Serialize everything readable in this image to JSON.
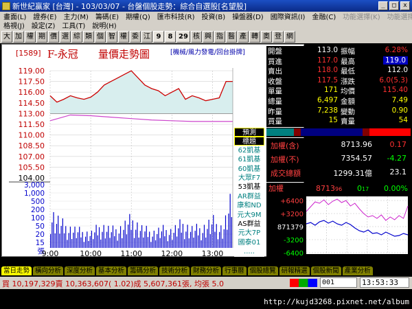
{
  "titlebar": {
    "title": "新世紀贏家 [台灣] - 103/03/07 - 台盤個股走勢：綜合自選股[名望股]",
    "min": "_",
    "max": "□",
    "close": "x"
  },
  "menus_row1": [
    "畫面(L)",
    "證券(E)",
    "主力(M)",
    "籌碼(E)",
    "期權(Q)",
    "匯市科技(R)",
    "投資(B)",
    "操盤器(D)",
    "國際資訊(I)",
    "金融(C)",
    "功能選擇(K)",
    "功能選擇(K)"
  ],
  "menus_row2": [
    "格視(J)",
    "設定(Z)",
    "工具(T)",
    "說明(H)"
  ],
  "toolbar_buttons": [
    "大",
    "加",
    "權",
    "期",
    "價",
    "選",
    "綜",
    "類",
    "個",
    "智",
    "權",
    "委",
    "江",
    "9",
    "8",
    "29",
    "核",
    "興",
    "指",
    "醫",
    "產",
    "轉",
    "奧",
    "登",
    "網"
  ],
  "chart": {
    "code": "[1589]",
    "name": "F-永冠",
    "subtitle": "量價走勢圖",
    "tags": "[機械/風力發電/回台掛牌]",
    "price_ticks": [
      "119.00",
      "117.50",
      "116.00",
      "114.50",
      "113.00",
      "111.50",
      "110.00",
      "108.50",
      "107.00",
      "105.50",
      "104.00"
    ],
    "volume_ticks": [
      "3,000",
      "1,000",
      "500",
      "200",
      "100",
      "50",
      "20",
      "15",
      "張"
    ],
    "time_ticks": [
      "9:00",
      "10:00",
      "11:00",
      "12:00",
      "13:00"
    ],
    "side_labels": [
      "預測",
      "標題",
      "62凱基",
      "61凱基",
      "60凱基",
      "大眾F7",
      "53凱基",
      "AR群益",
      "康和ND",
      "元大9M",
      "AS群益",
      "元大7P",
      "國泰01",
      "....."
    ]
  },
  "chart_data": {
    "type": "line",
    "title": "量價走勢圖",
    "xlabel": "",
    "ylabel": "",
    "x_ticks": [
      "9:00",
      "10:00",
      "11:00",
      "12:00",
      "13:00"
    ],
    "ylim": [
      104.0,
      119.0
    ],
    "series": [
      {
        "x": [
          "09:00",
          "09:10",
          "09:20",
          "09:30",
          "09:40",
          "09:50",
          "10:00",
          "10:10",
          "10:20",
          "10:30",
          "10:40",
          "10:50",
          "11:00",
          "11:10",
          "11:20",
          "11:30",
          "11:40",
          "11:50",
          "12:00",
          "12:10",
          "12:20",
          "12:30",
          "12:40",
          "12:50",
          "13:00",
          "13:10",
          "13:20",
          "13:30"
        ],
        "values": [
          115.5,
          114.6,
          115.0,
          115.5,
          115.2,
          115.0,
          115.3,
          116.0,
          117.0,
          117.5,
          118.0,
          118.5,
          119.0,
          118.0,
          117.0,
          116.5,
          116.2,
          115.5,
          116.0,
          116.5,
          115.0,
          115.5,
          115.2,
          114.8,
          115.0,
          115.2,
          117.5,
          117.5
        ]
      },
      {
        "x": [
          "09:00",
          "09:30",
          "10:00",
          "10:30",
          "11:00",
          "11:30",
          "12:00",
          "12:30",
          "13:00",
          "13:30"
        ],
        "values": [
          112.0,
          112.8,
          112.7,
          112.5,
          112.3,
          112.1,
          112.0,
          111.9,
          111.9,
          111.9
        ]
      }
    ],
    "volume": {
      "x": [
        "09:00",
        "09:15",
        "09:30",
        "09:45",
        "10:00",
        "10:15",
        "10:30",
        "10:45",
        "11:00",
        "11:15",
        "11:30",
        "11:45",
        "12:00",
        "12:15",
        "12:30",
        "12:45",
        "13:00",
        "13:15",
        "13:30"
      ],
      "values": [
        180,
        120,
        95,
        80,
        70,
        110,
        85,
        100,
        140,
        95,
        75,
        90,
        85,
        120,
        90,
        100,
        130,
        95,
        260
      ]
    },
    "reference_price": 113.0,
    "grid": true
  },
  "quote": {
    "rows": [
      {
        "l1": "開盤",
        "v1": "113.0",
        "c1": "#ffffff",
        "l2": "振幅",
        "v2": "6.28%",
        "c2": "#ff3030"
      },
      {
        "l1": "買進",
        "v1": "117.0",
        "c1": "#ff3030",
        "l2": "最高",
        "v2": "119.0",
        "c2": "#ffffff",
        "hl": true
      },
      {
        "l1": "賣出",
        "v1": "118.0",
        "c1": "#ff3030",
        "l2": "最低",
        "v2": "112.0",
        "c2": "#ffffff"
      },
      {
        "l1": "收盤",
        "v1": "117.5",
        "c1": "#ff3030",
        "l2": "漲跌",
        "v2": "6.0(5.3)",
        "c2": "#ff3030"
      },
      {
        "l1": "單量",
        "v1": "171",
        "c1": "#ffff00",
        "l2": "均價",
        "v2": "115.40",
        "c2": "#ff3030"
      },
      {
        "l1": "總量",
        "v1": "6,497",
        "c1": "#ffff00",
        "l2": "金額",
        "v2": "7.49",
        "c2": "#ffff00"
      },
      {
        "l1": "昨量",
        "v1": "7,238",
        "c1": "#ffff00",
        "l2": "變動",
        "v2": "0.90",
        "c2": "#ffff00"
      },
      {
        "l1": "買量",
        "v1": "15",
        "c1": "#ffff00",
        "l2": "賣量",
        "v2": "54",
        "c2": "#ffff00"
      }
    ]
  },
  "index": {
    "rows": [
      {
        "label": "加權(含)",
        "value": "8713.96",
        "change": "0.17",
        "change_color": "#ff3030"
      },
      {
        "label": "加權(不)",
        "value": "7354.57",
        "change": "-4.27",
        "change_color": "#00ff00"
      },
      {
        "label": "成交總額",
        "value": "1299.31億",
        "change": "23.1",
        "change_color": "#ffffff"
      }
    ]
  },
  "mini": {
    "label": "加權",
    "value": "8713",
    "value_small": "96",
    "change": "0",
    "change_small": "17",
    "pct": "0.00%",
    "ticks": [
      "+6400",
      "+3200",
      "871379",
      "-3200",
      "-6400"
    ]
  },
  "tabs": [
    "當日走勢",
    "橫向分析",
    "深度分析",
    "基本分析",
    "籌碼分析",
    "技術分析",
    "財務分析",
    "行事曆",
    "個股總覽",
    "研報精選",
    "個股新聞",
    "產業分析"
  ],
  "status": {
    "text": "買 10,197,329賣 10,363,607( 1.02)成 5,607,361張, 均張 5.0",
    "code": "001",
    "time": "13:53:33"
  },
  "watermark": "http://kujd3268.pixnet.net/album",
  "colors": {
    "up": "#ff3030",
    "down": "#00c000",
    "price_line": "#cc0000",
    "avg_line": "#cc44cc",
    "volume": "#0000cc"
  }
}
